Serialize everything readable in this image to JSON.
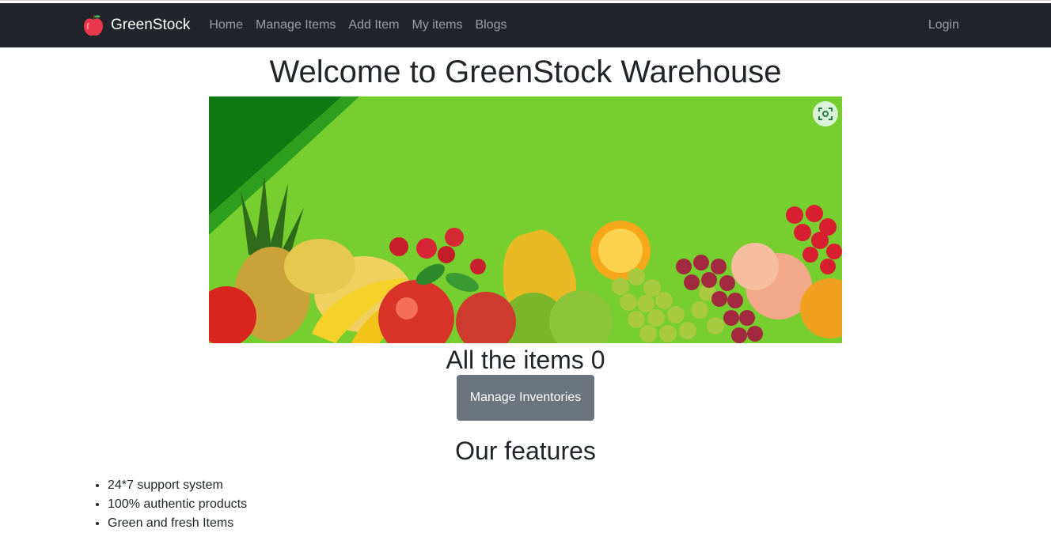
{
  "navbar": {
    "brand": "GreenStock",
    "links": [
      "Home",
      "Manage Items",
      "Add Item",
      "My items",
      "Blogs"
    ],
    "login": "Login"
  },
  "main": {
    "title": "Welcome to GreenStock Warehouse",
    "items_count": "All the items 0",
    "manage_button": "Manage Inventories",
    "features_title": "Our features",
    "features": [
      "24*7 support system",
      "100% authentic products",
      "Green and fresh Items"
    ]
  },
  "colors": {
    "navbar_bg": "#212529",
    "banner_green": "#76cf2f",
    "button_gray": "#6c757d"
  },
  "icons": {
    "brand": "apple-icon",
    "lens": "visual-search-icon"
  }
}
